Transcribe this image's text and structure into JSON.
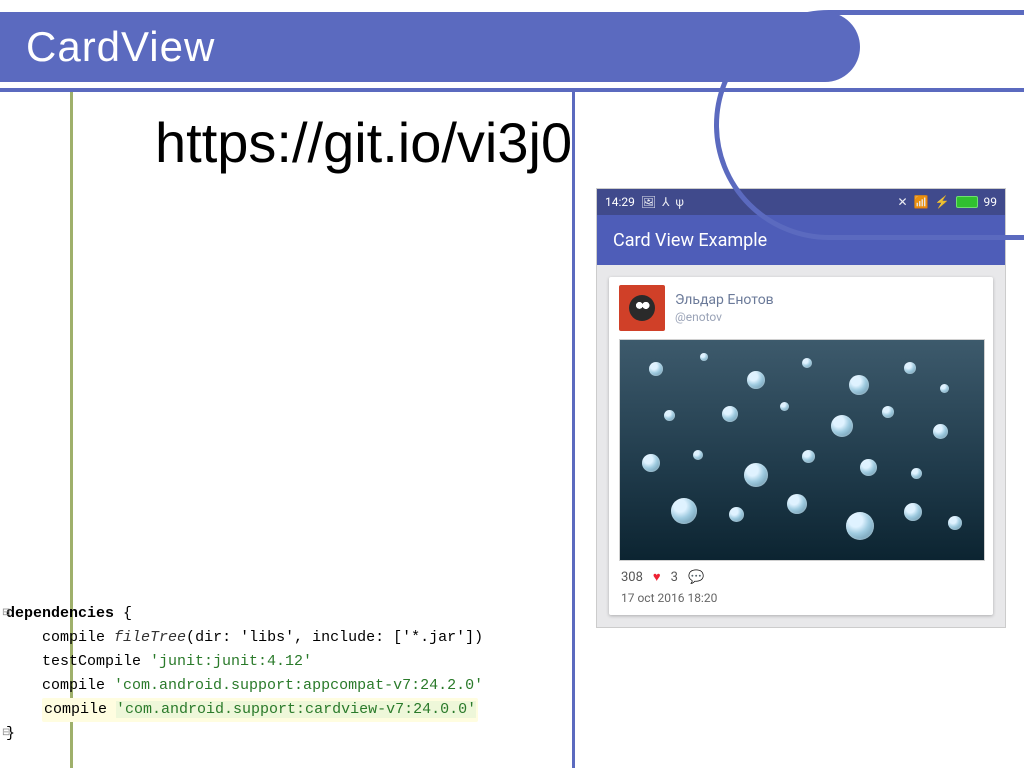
{
  "slide": {
    "title": "CardView",
    "url": "https://git.io/vi3j0"
  },
  "code": {
    "lines": [
      {
        "indent": 0,
        "plain": "dependencies {",
        "fold": "⊟"
      },
      {
        "indent": 1,
        "prefix": "compile ",
        "fn": "fileTree",
        "paren_open": "(",
        "args": "dir: 'libs', include: ['*.jar']",
        "paren_close": ")"
      },
      {
        "indent": 1,
        "prefix": "testCompile ",
        "str": "'junit:junit:4.12'"
      },
      {
        "indent": 1,
        "prefix": "compile ",
        "str": "'com.android.support:appcompat-v7:24.2.0'"
      },
      {
        "indent": 1,
        "prefix": "compile ",
        "str": "'com.android.support:cardview-v7:24.0.0'",
        "highlight": true
      },
      {
        "indent": 0,
        "plain": "}",
        "fold": "⊟"
      }
    ]
  },
  "phone": {
    "status": {
      "time": "14:29",
      "battery_pct": "99"
    },
    "app_title": "Card View Example",
    "post": {
      "author_name": "Эльдар Енотов",
      "author_handle": "@enotov",
      "likes": "308",
      "comments": "3",
      "date": "17 oct 2016 18:20"
    }
  }
}
